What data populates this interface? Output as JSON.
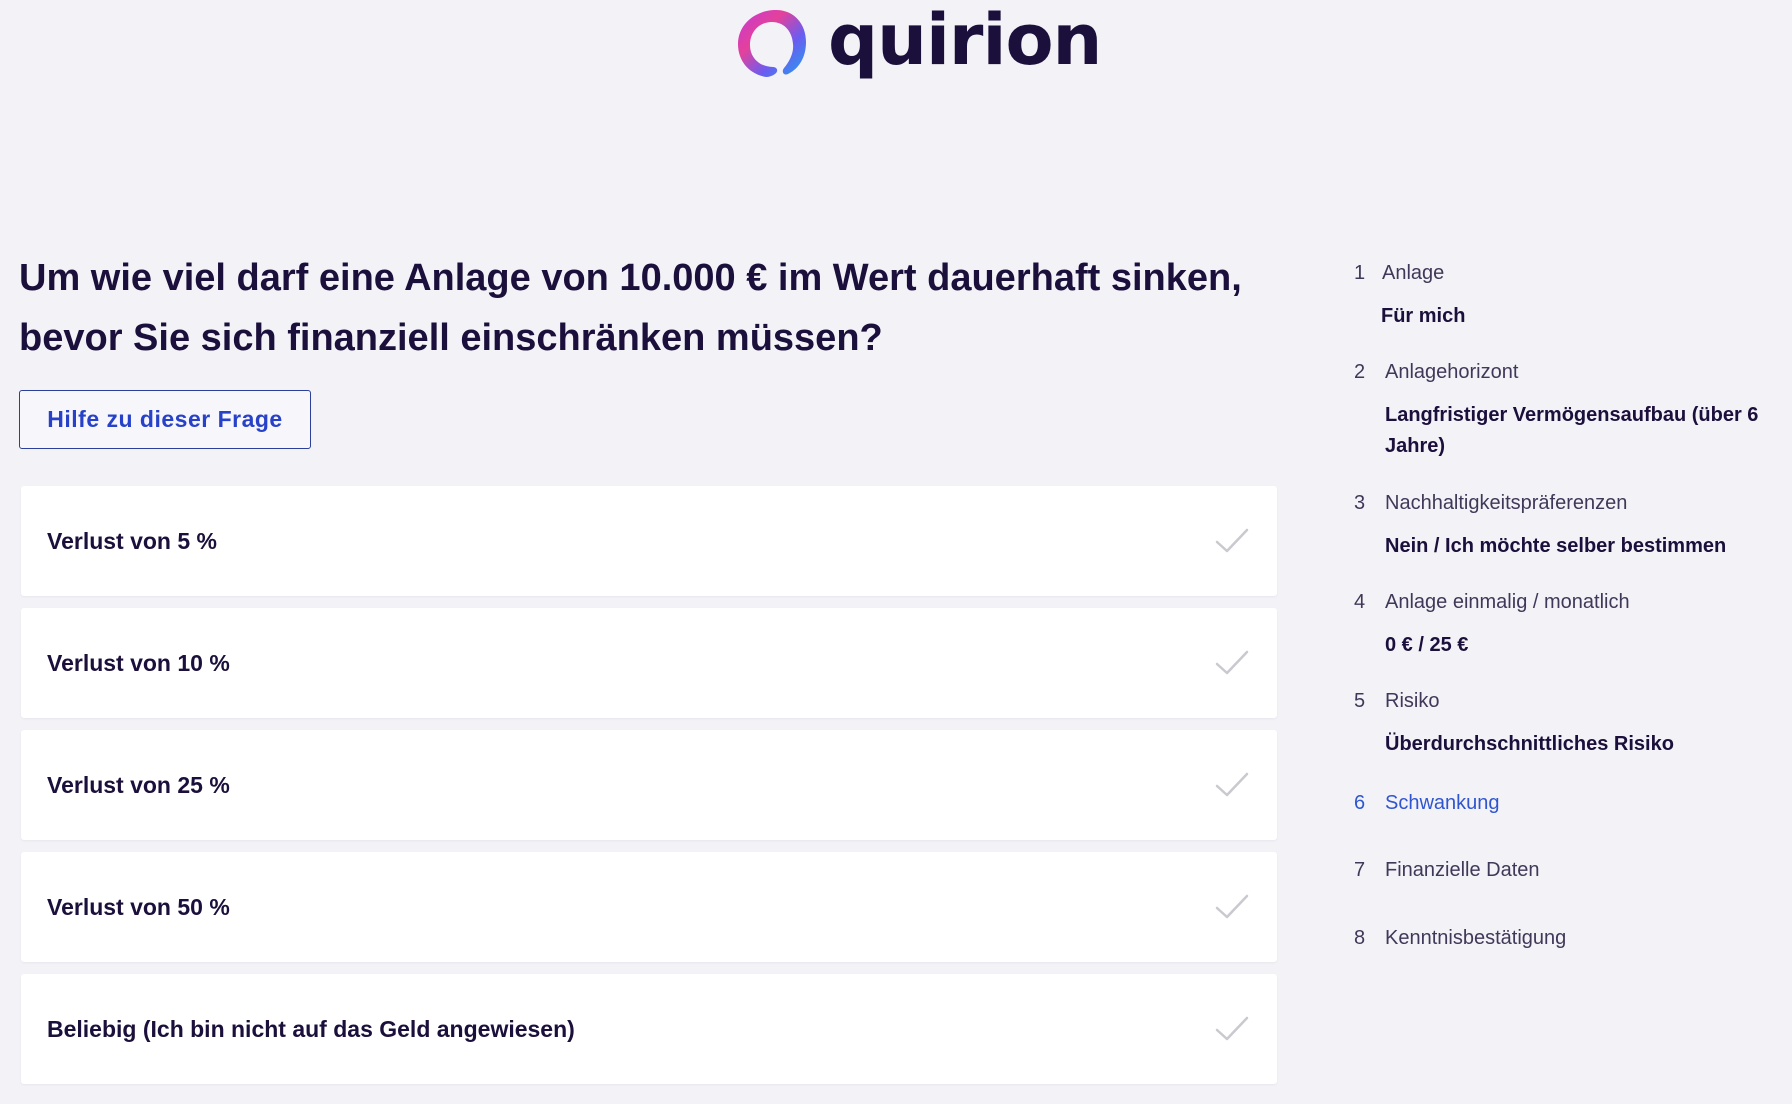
{
  "brand": {
    "name": "quirion"
  },
  "question": {
    "title": "Um wie viel darf eine Anlage von 10.000 € im Wert dauerhaft sinken, bevor Sie sich finanziell einschränken müssen?",
    "help_label": "Hilfe zu dieser Frage"
  },
  "options": [
    {
      "label": "Verlust von 5 %"
    },
    {
      "label": "Verlust von 10 %"
    },
    {
      "label": "Verlust von 25 %"
    },
    {
      "label": "Verlust von 50 %"
    },
    {
      "label": "Beliebig (Ich bin nicht auf das Geld angewiesen)"
    }
  ],
  "steps": [
    {
      "number": "1",
      "title": "Anlage",
      "value": "Für mich"
    },
    {
      "number": "2",
      "title": "Anlagehorizont",
      "value": "Langfristiger Vermögensaufbau (über 6 Jahre)"
    },
    {
      "number": "3",
      "title": "Nachhaltigkeitspräferenzen",
      "value": "Nein / Ich möchte selber bestimmen"
    },
    {
      "number": "4",
      "title": "Anlage einmalig / monatlich",
      "value": "0 € / 25 €"
    },
    {
      "number": "5",
      "title": "Risiko",
      "value": "Überdurchschnittliches Risiko"
    },
    {
      "number": "6",
      "title": "Schwankung",
      "value": ""
    },
    {
      "number": "7",
      "title": "Finanzielle Daten",
      "value": ""
    },
    {
      "number": "8",
      "title": "Kenntnisbestätigung",
      "value": ""
    }
  ],
  "active_step": "6",
  "colors": {
    "background": "#f3f2f7",
    "text": "#1b0f3b",
    "accent": "#2f56cf",
    "check": "#c9c9cf"
  },
  "icons": {
    "logo": "quirion-logo-icon",
    "option_check": "checkmark-icon"
  }
}
